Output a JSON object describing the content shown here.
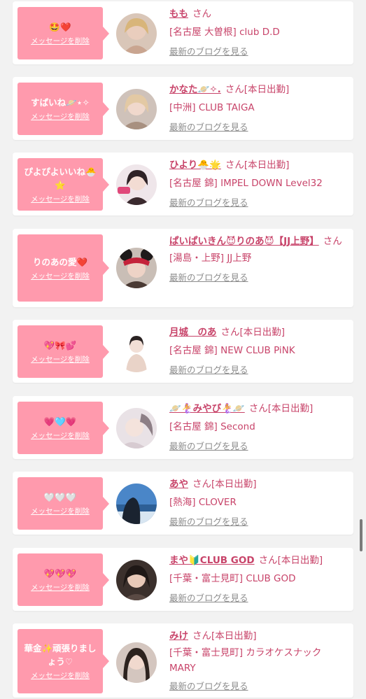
{
  "common": {
    "delete_label": "メッセージを削除",
    "blog_label": "最新のブログを見る",
    "san": "さん"
  },
  "colors": {
    "bubble": "#ff9aad",
    "accent": "#c8446a",
    "muted": "#8c8c8c",
    "background": "#f2f2f2"
  },
  "entries": [
    {
      "message": "🤩❤️",
      "name": "もも",
      "status": "",
      "shop": "[名古屋 大曽根] club D.D",
      "avatar_icon": "avatar-photo-blonde"
    },
    {
      "message": "すぱいね🪐⋆✧",
      "name": "かなた🪐✧.",
      "status": "[本日出勤]",
      "shop": "[中洲] CLUB TAIGA",
      "avatar_icon": "avatar-photo-light-hair"
    },
    {
      "message": "ぴよぴよいいね🐣⭐",
      "name": "ひより🐣🌟",
      "status": "[本日出勤]",
      "shop": "[名古屋 錦] IMPEL DOWN Level32",
      "avatar_icon": "avatar-photo-logo"
    },
    {
      "message": "りのあの愛❤️",
      "name": "ぱいぱいきん😈りのあ😈【JJ上野】",
      "status": "",
      "shop": "[湯島・上野] JJ上野",
      "avatar_icon": "avatar-photo-mouse-ears"
    },
    {
      "message": "💖🎀💕",
      "name": "月城　のあ",
      "status": "[本日出勤]",
      "shop": "[名古屋 錦] NEW CLUB PiNK",
      "avatar_icon": "avatar-photo-white-bg"
    },
    {
      "message": "💗🩵💗",
      "name": "🪐🧜‍♀️みやび🧜‍♀️🪐",
      "status": "[本日出勤]",
      "shop": "[名古屋 錦] Second",
      "avatar_icon": "avatar-photo-pale"
    },
    {
      "message": "🤍🤍🤍",
      "name": "あや",
      "status": "[本日出勤]",
      "shop": "[熱海] CLOVER",
      "avatar_icon": "avatar-photo-sea"
    },
    {
      "message": "💖💖💖",
      "name": "まや🔰CLUB GOD",
      "status": "[本日出勤]",
      "shop": "[千葉・富士見町] CLUB GOD",
      "avatar_icon": "avatar-photo-dark"
    },
    {
      "message": "華金✨頑張りましょう♡",
      "name": "みけ",
      "status": "[本日出勤]",
      "shop": "[千葉・富士見町] カラオケスナック MARY",
      "avatar_icon": "avatar-photo-long-hair"
    }
  ]
}
